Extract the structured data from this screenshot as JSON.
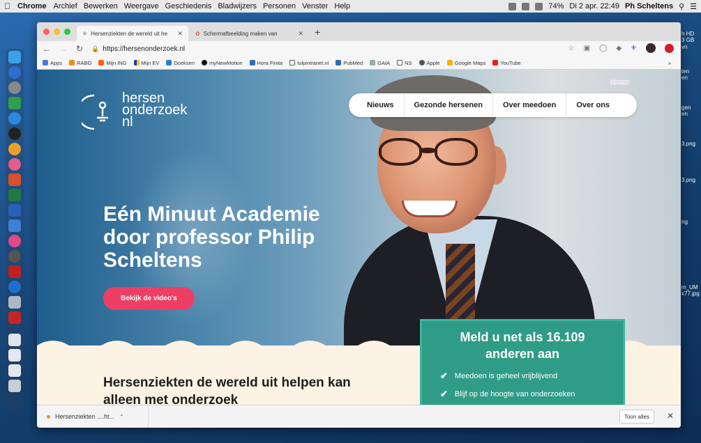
{
  "menubar": {
    "app": "Chrome",
    "items": [
      "Archief",
      "Bewerken",
      "Weergave",
      "Geschiedenis",
      "Bladwijzers",
      "Personen",
      "Venster",
      "Help"
    ],
    "battery": "74%",
    "clock": "Di 2 apr. 22:49",
    "user": "Ph Scheltens"
  },
  "right_files": [
    "h HD",
    "3 GB vri",
    "ten",
    "en",
    "gen",
    "en",
    "3.png",
    "3.png",
    "ng",
    "m_UM",
    "x77.jpg"
  ],
  "browser": {
    "tabs": [
      {
        "label": "Hersenziekten de wereld uit he",
        "close": "✕"
      },
      {
        "label": "Schermafbeelding maken van",
        "close": "✕"
      }
    ],
    "new_tab": "+",
    "url": "https://hersenonderzoek.nl",
    "bookmarks": [
      "Apps",
      "RABO",
      "Mijn ING",
      "Mijn EV",
      "Doeksen",
      "myNewMotion",
      "Hora Finita",
      "tulpintranet.nl",
      "PubMed",
      "GAIA",
      "NS",
      "Apple",
      "Google Maps",
      "YouTube"
    ],
    "bookmarks_more": "»"
  },
  "site": {
    "logo_lines": [
      "hersen",
      "onderzoek",
      "nl"
    ],
    "login": "Inloggen",
    "nav": [
      "Nieuws",
      "Gezonde hersenen",
      "Over meedoen",
      "Over ons"
    ],
    "headline": "Eén Minuut Academie door professor Philip Scheltens",
    "video_button": "Bekijk de video's",
    "subheadline": "Hersenziekten de wereld uit helpen kan alleen met onderzoek",
    "panel": {
      "title_pre": "Meld u net als",
      "count": "16.109",
      "title_post": "anderen aan",
      "checks": [
        "Meedoen is geheel vrijblijvend",
        "Blijf op de hoogte van onderzoeken"
      ]
    }
  },
  "downloads": {
    "file": "Hersenziekten ....ht...",
    "show_all": "Toon alles",
    "close": "✕"
  },
  "colors": {
    "accent_pink": "#ef3e63",
    "panel_green": "#2e9c86",
    "cream": "#fdf3e4"
  }
}
